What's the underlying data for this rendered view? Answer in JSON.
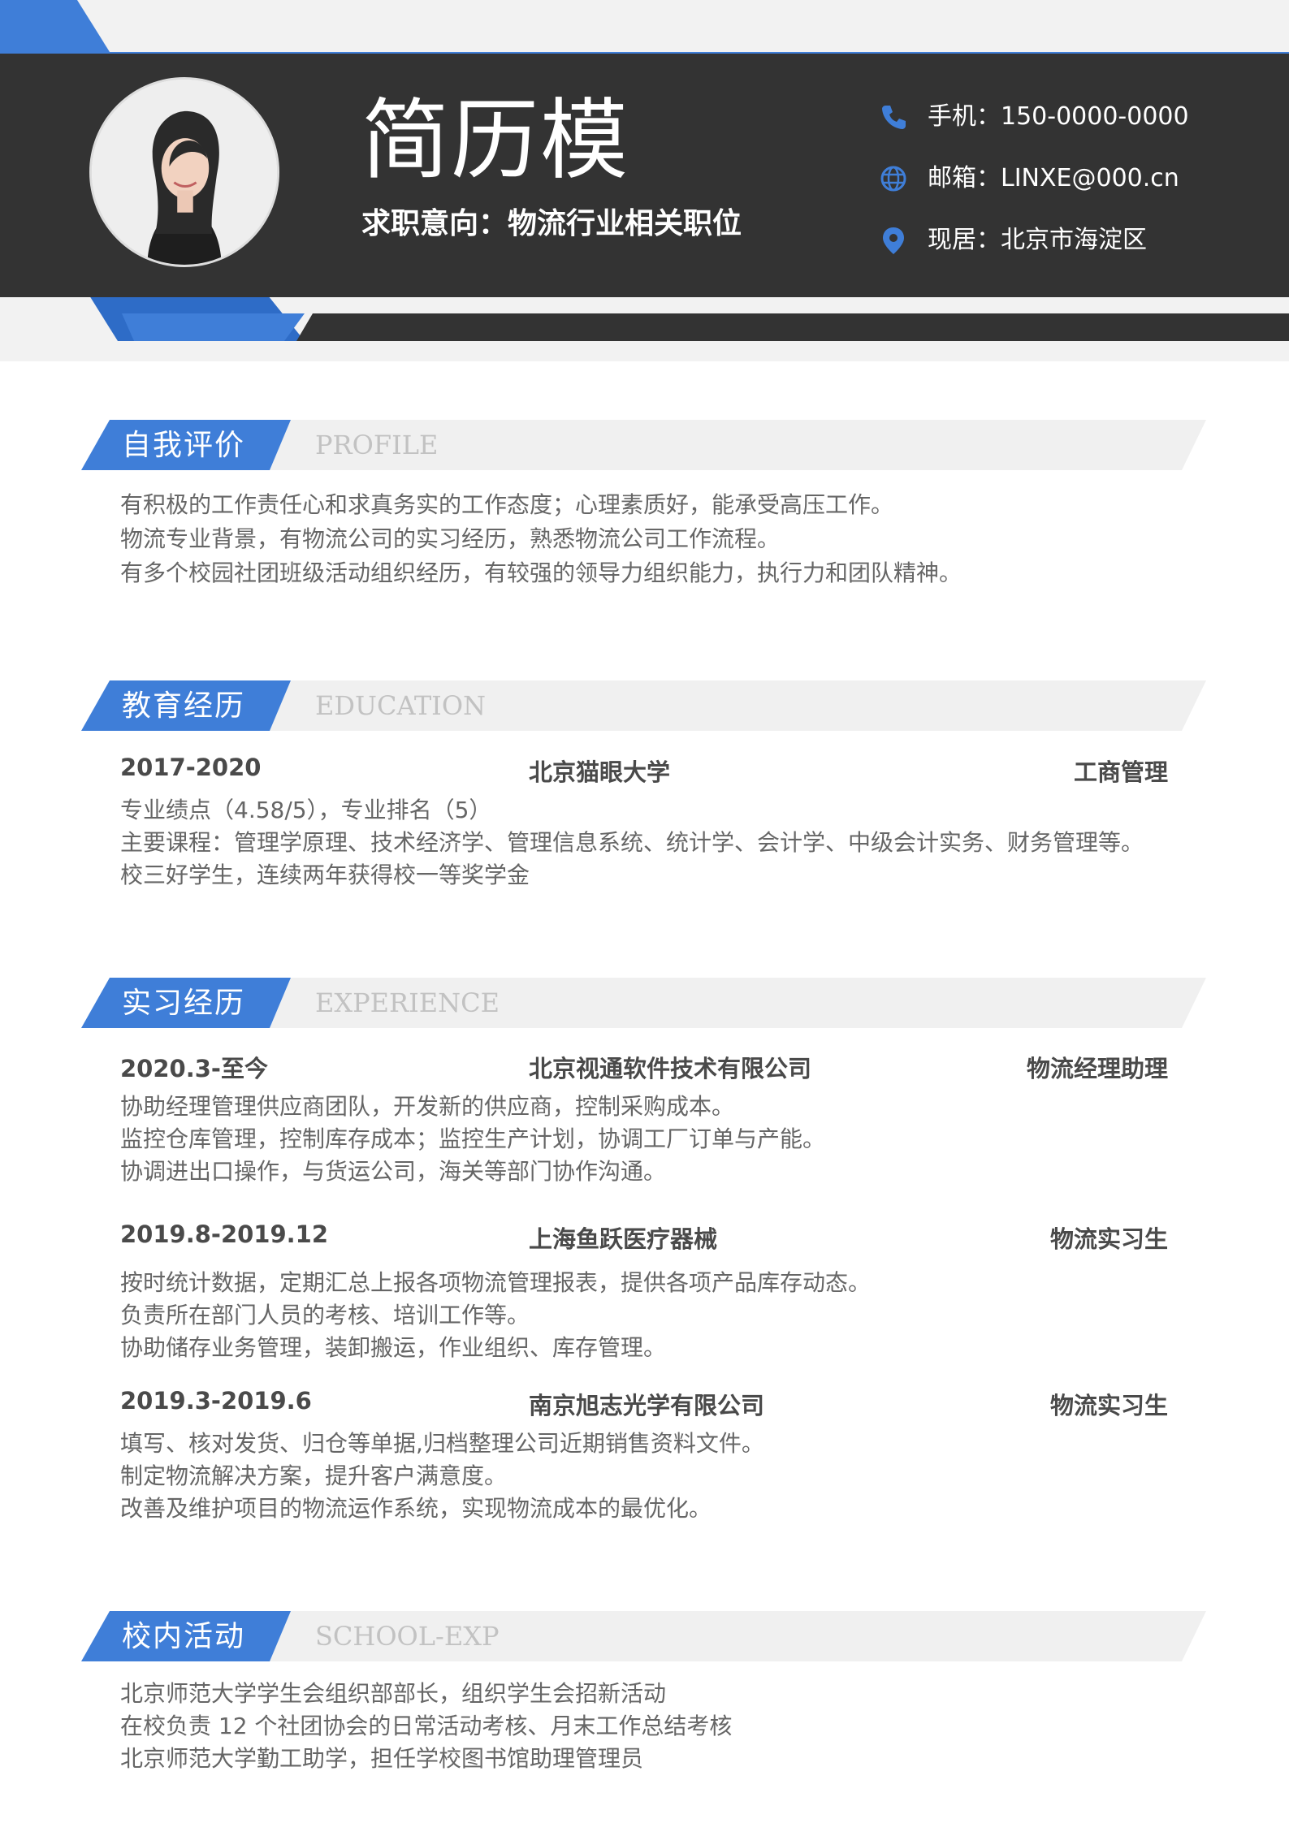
{
  "header": {
    "name": "简历模",
    "intent_label": "求职意向：物流行业相关职位",
    "contacts": [
      {
        "icon": "phone-icon",
        "label": "手机：150-0000-0000"
      },
      {
        "icon": "globe-icon",
        "label": "邮箱：LINXE@000.cn"
      },
      {
        "icon": "location-pin-icon",
        "label": "现居：北京市海淀区"
      }
    ]
  },
  "colors": {
    "accent": "#3f7ed8",
    "dark": "#333333",
    "light_band": "#f0f0f0"
  },
  "sections": {
    "profile": {
      "title_cn": "自我评价",
      "title_en": "PROFILE",
      "lines": [
        "有积极的工作责任心和求真务实的工作态度；心理素质好，能承受高压工作。",
        "物流专业背景，有物流公司的实习经历，熟悉物流公司工作流程。",
        "有多个校园社团班级活动组织经历，有较强的领导力组织能力，执行力和团队精神。"
      ]
    },
    "education": {
      "title_cn": "教育经历",
      "title_en": "EDUCATION",
      "period": "2017-2020",
      "school": "北京猫眼大学",
      "major": "工商管理",
      "lines": [
        "专业绩点（4.58/5），专业排名（5）",
        "主要课程：管理学原理、技术经济学、管理信息系统、统计学、会计学、中级会计实务、财务管理等。",
        "校三好学生，连续两年获得校一等奖学金"
      ]
    },
    "experience": {
      "title_cn": "实习经历",
      "title_en": "EXPERIENCE",
      "items": [
        {
          "period": "2020.3-至今",
          "company": "北京视通软件技术有限公司",
          "role": "物流经理助理",
          "lines": [
            "协助经理管理供应商团队，开发新的供应商，控制采购成本。",
            "监控仓库管理，控制库存成本；监控生产计划，协调工厂订单与产能。",
            "协调进出口操作，与货运公司，海关等部门协作沟通。"
          ]
        },
        {
          "period": "2019.8-2019.12",
          "company": "上海鱼跃医疗器械",
          "role": "物流实习生",
          "lines": [
            "按时统计数据，定期汇总上报各项物流管理报表，提供各项产品库存动态。",
            "负责所在部门人员的考核、培训工作等。",
            "协助储存业务管理，装卸搬运，作业组织、库存管理。"
          ]
        },
        {
          "period": "2019.3-2019.6",
          "company": "南京旭志光学有限公司",
          "role": "物流实习生",
          "lines": [
            "填写、核对发货、归仓等单据,归档整理公司近期销售资料文件。",
            "制定物流解决方案，提升客户满意度。",
            "改善及维护项目的物流运作系统，实现物流成本的最优化。"
          ]
        }
      ]
    },
    "school": {
      "title_cn": "校内活动",
      "title_en": "SCHOOL-EXP",
      "lines": [
        "北京师范大学学生会组织部部长，组织学生会招新活动",
        "在校负责 12 个社团协会的日常活动考核、月末工作总结考核",
        "北京师范大学勤工助学，担任学校图书馆助理管理员"
      ]
    }
  }
}
